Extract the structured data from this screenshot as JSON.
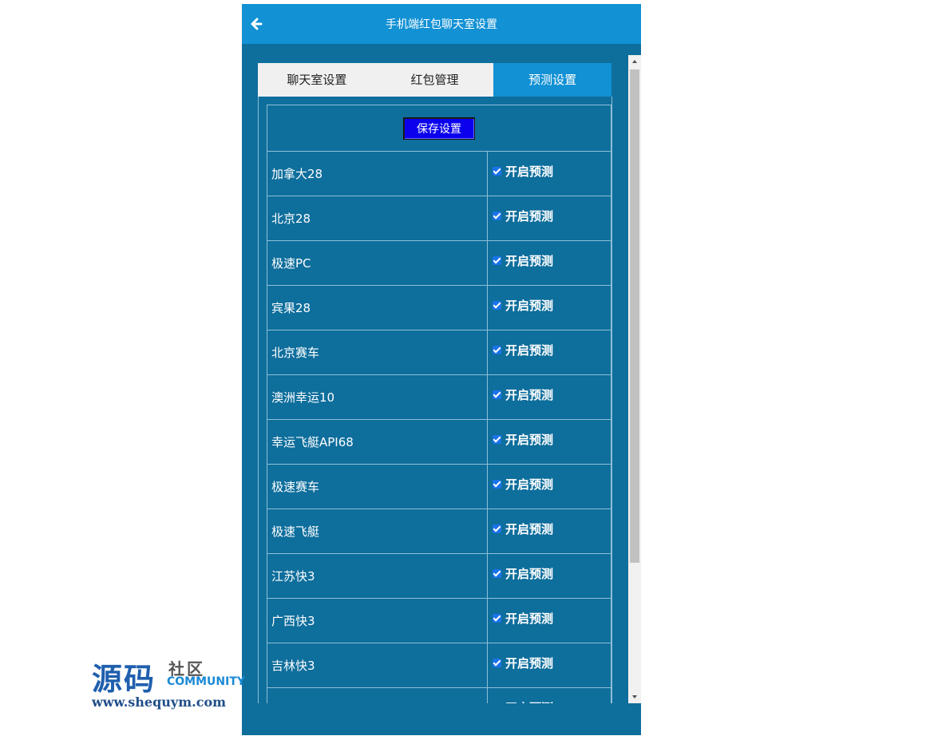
{
  "header": {
    "title": "手机端红包聊天室设置",
    "back_icon": "arrow-left-icon"
  },
  "tabs": [
    {
      "label": "聊天室设置",
      "active": false
    },
    {
      "label": "红包管理",
      "active": false
    },
    {
      "label": "预测设置",
      "active": true
    }
  ],
  "toolbar": {
    "save_label": "保存设置"
  },
  "rows": [
    {
      "name": "加拿大28",
      "option": "开启预测",
      "checked": true
    },
    {
      "name": "北京28",
      "option": "开启预测",
      "checked": true
    },
    {
      "name": "极速PC",
      "option": "开启预测",
      "checked": true
    },
    {
      "name": "宾果28",
      "option": "开启预测",
      "checked": true
    },
    {
      "name": "北京赛车",
      "option": "开启预测",
      "checked": true
    },
    {
      "name": "澳洲幸运10",
      "option": "开启预测",
      "checked": true
    },
    {
      "name": "幸运飞艇API68",
      "option": "开启预测",
      "checked": true
    },
    {
      "name": "极速赛车",
      "option": "开启预测",
      "checked": true
    },
    {
      "name": "极速飞艇",
      "option": "开启预测",
      "checked": true
    },
    {
      "name": "江苏快3",
      "option": "开启预测",
      "checked": true
    },
    {
      "name": "广西快3",
      "option": "开启预测",
      "checked": true
    },
    {
      "name": "吉林快3",
      "option": "开启预测",
      "checked": true
    },
    {
      "name": "",
      "option": "开启预测",
      "checked": true
    }
  ],
  "watermark": {
    "big": "源码",
    "small": "社区",
    "community": "COMMUNITY",
    "url": "www.shequym.com"
  },
  "colors": {
    "header": "#1291d4",
    "body": "#0e6e9c",
    "save_button": "#0a00ee"
  }
}
